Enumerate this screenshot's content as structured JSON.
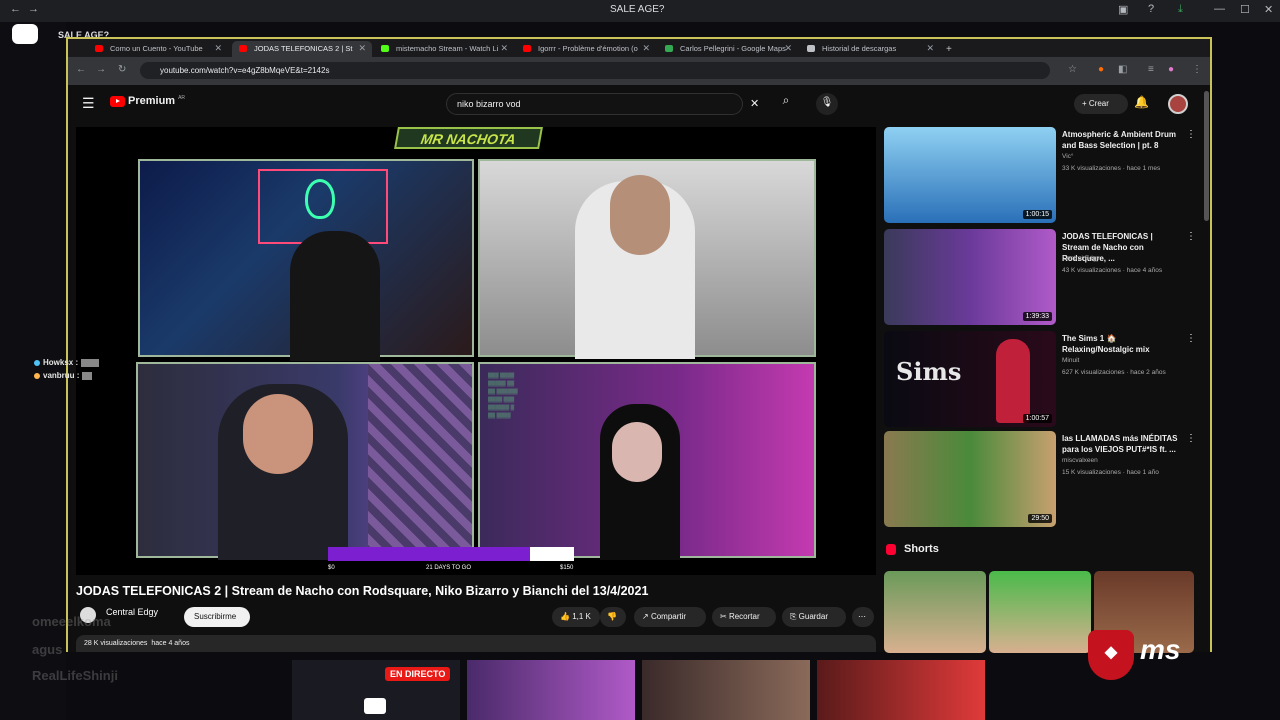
{
  "discord": {
    "title": "SALE AGE?",
    "channel_overlay": "SALE AGE?"
  },
  "browser": {
    "url": "youtube.com/watch?v=e4gZ8bMqeVE&t=2142s",
    "tabs": [
      {
        "label": "Como un Cuento - YouTube",
        "color": "#ff0000"
      },
      {
        "label": "JODAS TELEFONICAS 2 | St",
        "color": "#ff0000"
      },
      {
        "label": "mistemacho Stream - Watch Li",
        "color": "#53fc18"
      },
      {
        "label": "Igorrr - Problème d'émotion (o",
        "color": "#ff0000"
      },
      {
        "label": "Carlos Pellegrini - Google Maps",
        "color": "#34a853"
      },
      {
        "label": "Historial de descargas",
        "color": "#bdc1c6"
      }
    ]
  },
  "youtube": {
    "logo_text": "Premium",
    "region": "AR",
    "search_value": "niko bizarro vod",
    "create_label": "Crear",
    "video": {
      "banner_text": "MR NACHOTA",
      "goal_left": "$0",
      "goal_mid": "21 DAYS TO GO",
      "goal_right": "$150",
      "goal_progress": 0.82,
      "title": "JODAS TELEFONICAS 2 | Stream de Nacho con Rodsquare, Niko Bizarro y Bianchi del 13/4/2021",
      "channel": "Central Edgy",
      "subscribe_label": "Suscribirme",
      "likes": "1,1 K",
      "share_label": "Compartir",
      "clip_label": "Recortar",
      "save_label": "Guardar",
      "views": "28 K visualizaciones",
      "age": "hace 4 años"
    },
    "recommendations": [
      {
        "title": "Atmospheric & Ambient Drum and Bass Selection | pt. 8",
        "channel": "Vic°",
        "meta": "33 K visualizaciones · hace 1 mes",
        "duration": "1:00:15"
      },
      {
        "title": "JODAS TELEFONICAS | Stream de Nacho con Rodsquare, ...",
        "channel": "Central Edgy",
        "meta": "43 K visualizaciones · hace 4 años",
        "duration": "1:39:33"
      },
      {
        "title": "The Sims 1 🏠 Relaxing/Nostalgic mix",
        "channel": "Minuit",
        "meta": "627 K visualizaciones · hace 2 años",
        "duration": "1:00:57"
      },
      {
        "title": "las LLAMADAS más INÉDITAS para los VIEJOS PUT#*IS ft. ...",
        "channel": "miscvalxeen",
        "meta": "15 K visualizaciones · hace 1 año",
        "duration": "29:50"
      }
    ],
    "shorts_label": "Shorts"
  },
  "stream_chat": [
    {
      "user": "Howksx :",
      "color": "#4fc3f7"
    },
    {
      "user": "vanbruu :",
      "color": "#ffb74d"
    }
  ],
  "ghost_chat": [
    "omeeelkoma",
    "agus",
    "RealLifeShinji"
  ],
  "live_badge": "EN DIRECTO",
  "msi_text": "ms"
}
